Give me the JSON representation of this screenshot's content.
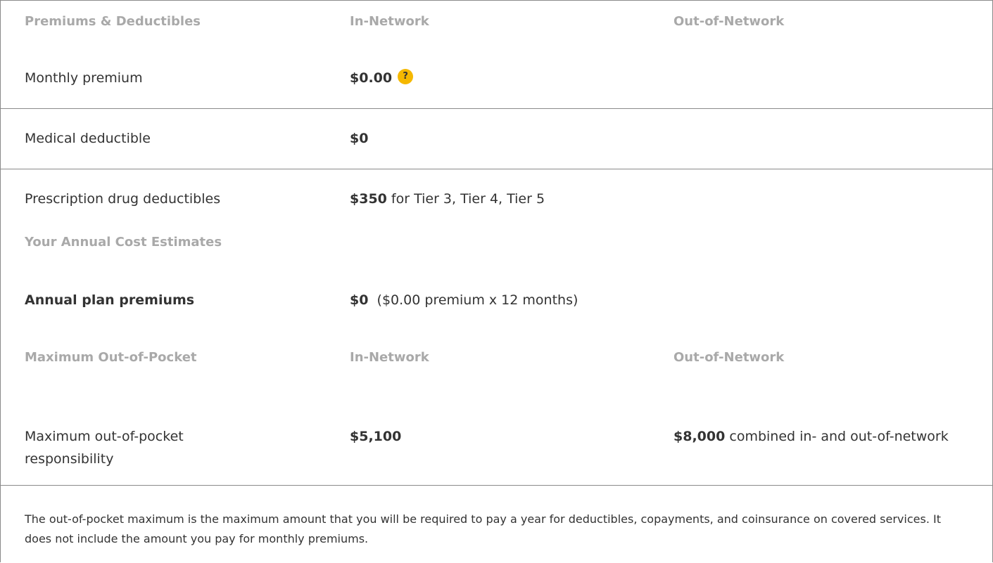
{
  "premiums_section": {
    "header_label": "Premiums & Deductibles",
    "in_network_header": "In-Network",
    "out_network_header": "Out-of-Network"
  },
  "monthly_premium": {
    "label": "Monthly premium",
    "value": "$0.00",
    "help_icon": "?"
  },
  "medical_deductible": {
    "label": "Medical deductible",
    "value": "$0"
  },
  "rx_deductible": {
    "label": "Prescription drug deductibles",
    "value": "$350",
    "detail": " for Tier 3, Tier 4, Tier 5"
  },
  "annual_section": {
    "header_label": "Your Annual Cost Estimates"
  },
  "annual_premiums": {
    "label": "Annual plan premiums",
    "value": "$0",
    "detail": "  ($0.00 premium x 12 months)"
  },
  "moop_section": {
    "header_label": "Maximum Out-of-Pocket",
    "in_network_header": "In-Network",
    "out_network_header": "Out-of-Network"
  },
  "moop": {
    "label": "Maximum out-of-pocket responsibility",
    "in_value": "$5,100",
    "out_value": "$8,000",
    "out_detail": " combined in- and out-of-network"
  },
  "moop_note": "The out-of-pocket maximum is the maximum amount that you will be required to pay a year for deductibles, copayments, and coinsurance on covered services. It does not include the amount you pay for monthly premiums.",
  "colors": {
    "header_text": "#a9a9a9",
    "body_text": "#333333",
    "border": "#8a8a8a",
    "help_icon_bg": "#f5b800"
  }
}
